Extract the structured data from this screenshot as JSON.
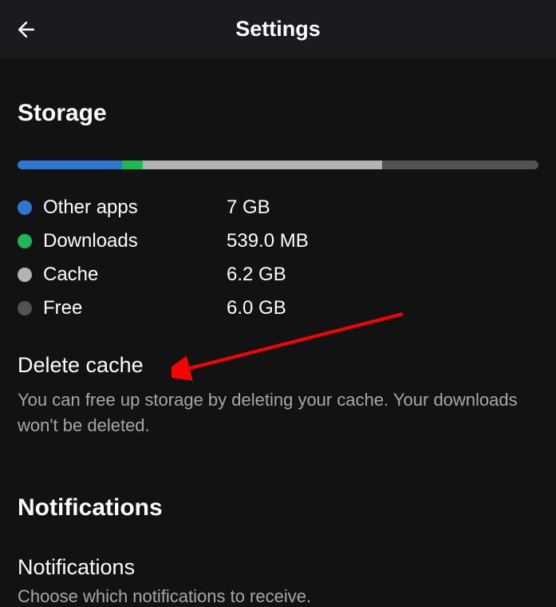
{
  "header": {
    "title": "Settings"
  },
  "storage": {
    "section_title": "Storage",
    "bar": {
      "other_pct": 20,
      "downloads_pct": 4,
      "cache_pct": 46,
      "free_pct": 30
    },
    "legend": [
      {
        "label": "Other apps",
        "value": "7 GB"
      },
      {
        "label": "Downloads",
        "value": "539.0 MB"
      },
      {
        "label": "Cache",
        "value": "6.2 GB"
      },
      {
        "label": "Free",
        "value": "6.0 GB"
      }
    ],
    "delete_cache": {
      "title": "Delete cache",
      "desc": "You can free up storage by deleting your cache. Your downloads won't be deleted."
    }
  },
  "notifications": {
    "section_title": "Notifications",
    "setting": {
      "title": "Notifications",
      "desc": "Choose which notifications to receive."
    }
  }
}
